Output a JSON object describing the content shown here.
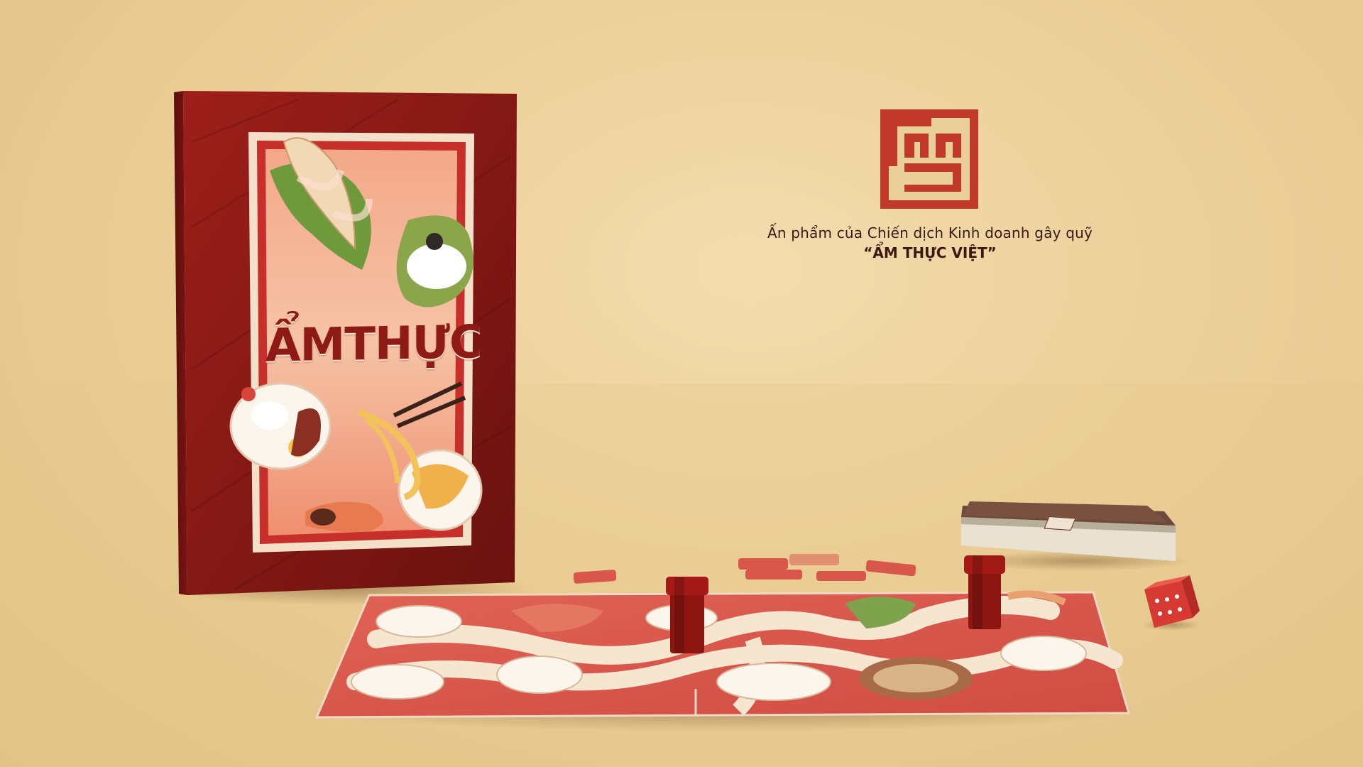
{
  "scene": {
    "description_label": "Board game product render",
    "colors": {
      "background": "#ebcf98",
      "box_red": "#8e1a16",
      "board_red": "#d9574a",
      "cream": "#f6e5cf"
    }
  },
  "brand": {
    "logo_icon": "square-seal-logo",
    "caption_line1": "Ấn phẩm của Chiến dịch Kinh doanh gây quỹ",
    "caption_line2": "“ẨM THỰC VIỆT”"
  },
  "box": {
    "title": "ẨMTHỰC"
  },
  "pieces": {
    "dice_icon": "dice-icon",
    "pawn_icon": "pawn-icon",
    "card_deck_icon": "card-deck-icon"
  }
}
